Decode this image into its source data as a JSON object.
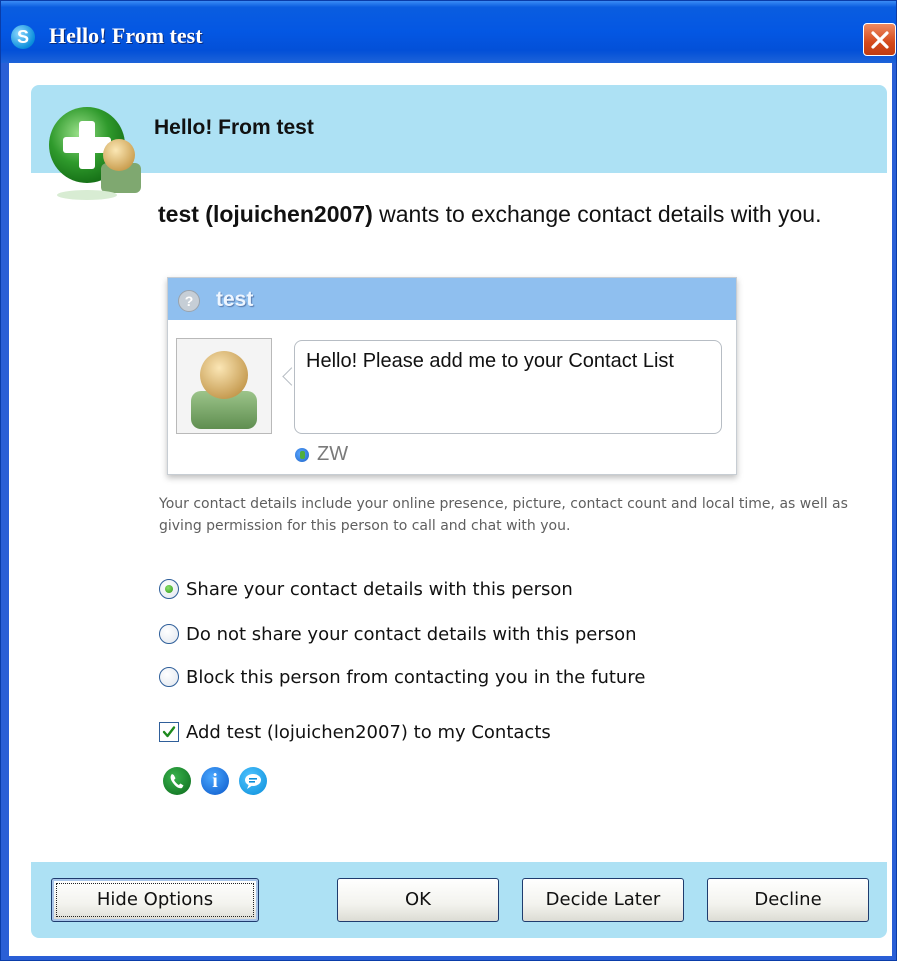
{
  "window": {
    "title": "Hello! From test",
    "app_icon": "skype-icon",
    "close_icon": "close-icon"
  },
  "header": {
    "title": "Hello! From test",
    "icon": "add-contact-icon"
  },
  "message": {
    "name": "test (lojuichen2007)",
    "text": " wants to exchange contact details with you."
  },
  "card": {
    "contact_name": "test",
    "status_icon": "unknown-status-icon",
    "greeting": "Hello! Please add me to your Contact List",
    "country": "ZW",
    "country_icon": "globe-icon"
  },
  "info_text": "Your contact details include your online presence, picture, contact count and local time, as well as giving permission for this person to call and chat with you.",
  "options": [
    {
      "label": "Share your contact details with this person",
      "checked": true
    },
    {
      "label": "Do not share your contact details with this person",
      "checked": false
    },
    {
      "label": "Block this person from contacting you in the future",
      "checked": false
    }
  ],
  "add_contact": {
    "label": "Add test (lojuichen2007) to my Contacts",
    "checked": true
  },
  "action_icons": [
    "call-icon",
    "profile-icon",
    "chat-icon"
  ],
  "buttons": {
    "hide_options": "Hide Options",
    "ok": "OK",
    "decide_later": "Decide Later",
    "decline": "Decline"
  },
  "colors": {
    "title_bar": "#0457e3",
    "band": "#ade1f4",
    "card_header": "#8fbfef",
    "close_button": "#d4491b"
  }
}
